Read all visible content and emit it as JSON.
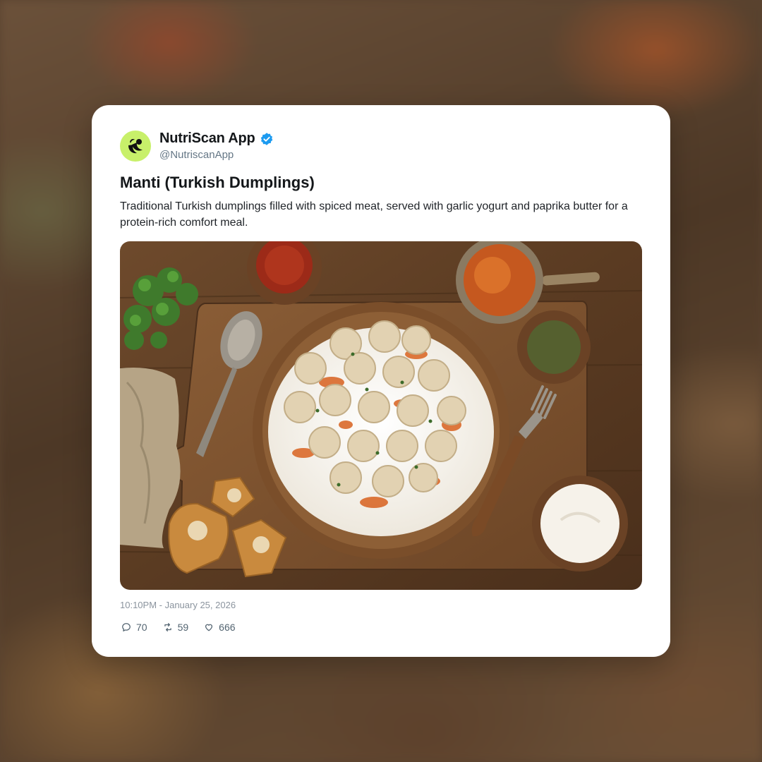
{
  "post": {
    "author_name": "NutriScan App",
    "author_handle": "@NutriscanApp",
    "verified": true,
    "title": "Manti (Turkish Dumplings)",
    "body": "Traditional Turkish dumplings filled with spiced meat, served with garlic yogurt and paprika butter for a protein-rich comfort meal.",
    "timestamp": "10:10PM - January 25, 2026",
    "image_icon": "food-photo",
    "stats": {
      "replies": "70",
      "reposts": "59",
      "likes": "666"
    }
  },
  "colors": {
    "avatar_bg": "#c8f06a",
    "verified_badge": "#1d9bf0",
    "card_bg": "#ffffff",
    "text_primary": "#14171a",
    "text_secondary": "#657786"
  },
  "icons": {
    "avatar": "nutriscan-logo-icon",
    "verified": "verified-badge-icon",
    "reply": "reply-icon",
    "repost": "repost-icon",
    "like": "heart-icon"
  }
}
